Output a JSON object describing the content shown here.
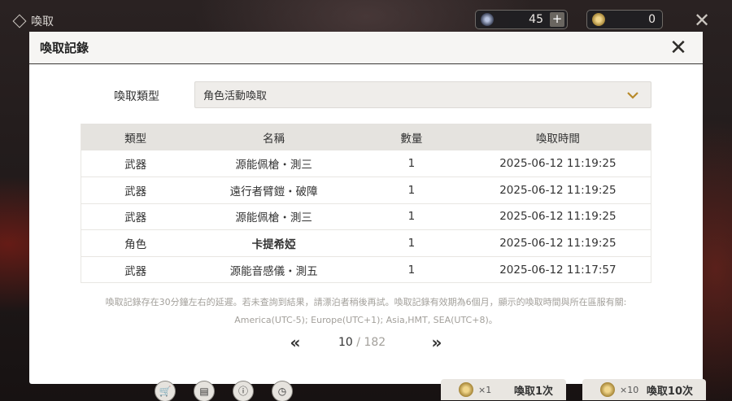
{
  "topbar": {
    "title": "喚取",
    "currencies": [
      {
        "icon": "star-icon",
        "value": "45"
      },
      {
        "icon": "coin-icon",
        "value": "0"
      }
    ]
  },
  "modal": {
    "title": "喚取記錄",
    "filter": {
      "label": "喚取類型",
      "selected": "角色活動喚取"
    },
    "table": {
      "headers": [
        "類型",
        "名稱",
        "數量",
        "喚取時間"
      ],
      "rows": [
        {
          "type": "武器",
          "name": "源能佩槍・測三",
          "qty": "1",
          "time": "2025-06-12 11:19:25"
        },
        {
          "type": "武器",
          "name": "遠行者臂鎧・破障",
          "qty": "1",
          "time": "2025-06-12 11:19:25"
        },
        {
          "type": "武器",
          "name": "源能佩槍・測三",
          "qty": "1",
          "time": "2025-06-12 11:19:25"
        },
        {
          "type": "角色",
          "name": "卡提希婭",
          "qty": "1",
          "time": "2025-06-12 11:19:25"
        },
        {
          "type": "武器",
          "name": "源能音感儀・測五",
          "qty": "1",
          "time": "2025-06-12 11:17:57"
        }
      ]
    },
    "note_line1": "喚取記錄存在30分鐘左右的延遲。若未查詢到結果，請漂泊者稍後再試。喚取記錄有效期為6個月，顯示的喚取時間與所在區服有關:",
    "note_line2": "America(UTC-5); Europe(UTC+1); Asia,HMT, SEA(UTC+8)。",
    "pagination": {
      "prev": "«",
      "next": "»",
      "current": "10",
      "total": " / 182"
    }
  },
  "bottom": {
    "pull_one": {
      "mult": "×1",
      "label": "喚取1次"
    },
    "pull_ten": {
      "mult": "×10",
      "label": "喚取10次"
    }
  },
  "colors": {
    "highlight_name": "#e0a52a",
    "header_bg": "#e5e3df",
    "modal_bg": "#ffffff"
  }
}
